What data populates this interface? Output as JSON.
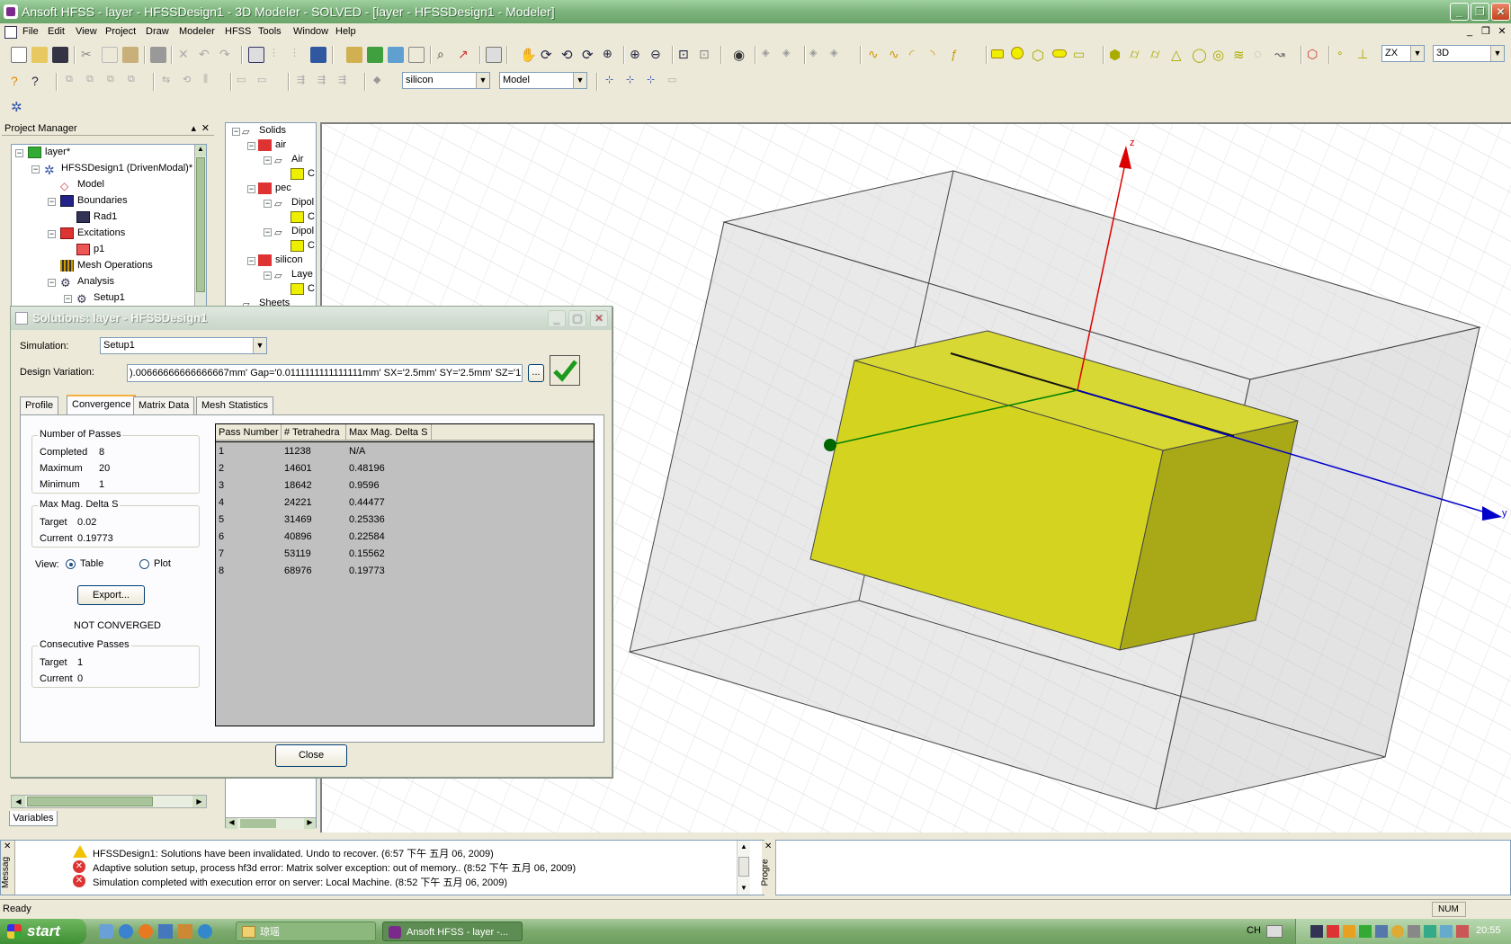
{
  "window": {
    "title": "Ansoft HFSS  - layer - HFSSDesign1 - 3D Modeler - SOLVED - [layer - HFSSDesign1 - Modeler]"
  },
  "menu": [
    "File",
    "Edit",
    "View",
    "Project",
    "Draw",
    "Modeler",
    "HFSS",
    "Tools",
    "Window",
    "Help"
  ],
  "toolbar": {
    "material_combo": "silicon",
    "model_combo": "Model",
    "plane_combo": "ZX",
    "view_combo": "3D"
  },
  "project_manager": {
    "title": "Project Manager",
    "tree": [
      {
        "label": "layer*",
        "icon": "project-icon"
      },
      {
        "label": "HFSSDesign1 (DrivenModal)*",
        "icon": "design-icon"
      },
      {
        "label": "Model",
        "icon": "model-icon"
      },
      {
        "label": "Boundaries",
        "icon": "boundaries-icon"
      },
      {
        "label": "Rad1",
        "icon": "radiation-boundary-icon"
      },
      {
        "label": "Excitations",
        "icon": "excitations-icon"
      },
      {
        "label": "p1",
        "icon": "port-icon"
      },
      {
        "label": "Mesh Operations",
        "icon": "mesh-icon"
      },
      {
        "label": "Analysis",
        "icon": "analysis-icon"
      },
      {
        "label": "Setup1",
        "icon": "setup-icon"
      }
    ],
    "variables_tab": "Variables"
  },
  "history_tree": [
    {
      "label": "Solids"
    },
    {
      "label": "air"
    },
    {
      "label": "Air"
    },
    {
      "label": "C"
    },
    {
      "label": "pec"
    },
    {
      "label": "Dipol"
    },
    {
      "label": "C"
    },
    {
      "label": "Dipol"
    },
    {
      "label": "C"
    },
    {
      "label": "silicon"
    },
    {
      "label": "Laye"
    },
    {
      "label": "C"
    },
    {
      "label": "Sheets"
    }
  ],
  "dialog": {
    "title": "Solutions: layer - HFSSDesign1",
    "simulation_label": "Simulation:",
    "simulation_value": "Setup1",
    "design_variation_label": "Design Variation:",
    "design_variation_value": ").00666666666666667mm' Gap='0.0111111111111111mm' SX='2.5mm' SY='2.5mm' SZ='1.5mm'",
    "ellipsis": "...",
    "tabs": [
      "Profile",
      "Convergence",
      "Matrix Data",
      "Mesh Statistics"
    ],
    "passes": {
      "title": "Number of Passes",
      "completed_label": "Completed",
      "completed": "8",
      "maximum_label": "Maximum",
      "maximum": "20",
      "minimum_label": "Minimum",
      "minimum": "1"
    },
    "delta": {
      "title": "Max Mag. Delta S",
      "target_label": "Target",
      "target": "0.02",
      "current_label": "Current",
      "current": "0.19773"
    },
    "view_label": "View:",
    "view_table": "Table",
    "view_plot": "Plot",
    "export_button": "Export...",
    "status": "NOT CONVERGED",
    "consecutive": {
      "title": "Consecutive Passes",
      "target_label": "Target",
      "target": "1",
      "current_label": "Current",
      "current": "0"
    },
    "grid_headers": [
      "Pass Number",
      "# Tetrahedra",
      "Max Mag. Delta S"
    ],
    "grid_rows": [
      [
        "1",
        "11238",
        "N/A"
      ],
      [
        "2",
        "14601",
        "0.48196"
      ],
      [
        "3",
        "18642",
        "0.9596"
      ],
      [
        "4",
        "24221",
        "0.44477"
      ],
      [
        "5",
        "31469",
        "0.25336"
      ],
      [
        "6",
        "40896",
        "0.22584"
      ],
      [
        "7",
        "53119",
        "0.15562"
      ],
      [
        "8",
        "68976",
        "0.19773"
      ]
    ],
    "close_button": "Close"
  },
  "viewport": {
    "axis_z": "z",
    "axis_y": "y"
  },
  "messages": {
    "side_label": "Messag",
    "lines": [
      {
        "type": "warning",
        "text": "HFSSDesign1: Solutions have been invalidated. Undo to recover. (6:57 下午  五月 06, 2009)"
      },
      {
        "type": "error",
        "text": "Adaptive solution setup, process hf3d error: Matrix solver exception: out of memory.. (8:52 下午  五月 06, 2009)"
      },
      {
        "type": "error",
        "text": "Simulation completed with execution error on server: Local Machine. (8:52 下午  五月 06, 2009)"
      }
    ]
  },
  "progress": {
    "side_label": "Progre"
  },
  "statusbar": {
    "text": "Ready",
    "num": "NUM"
  },
  "taskbar": {
    "start": "start",
    "items": [
      "琼瑶",
      "Ansoft HFSS  - layer -..."
    ],
    "lang": "CH",
    "clock": "20:55"
  },
  "colors": {
    "accent_green": "#7fb57f",
    "solid_yellow": "#d4d420",
    "axis_x": "#008000",
    "axis_y": "#0000cc",
    "axis_z": "#dd0000"
  }
}
